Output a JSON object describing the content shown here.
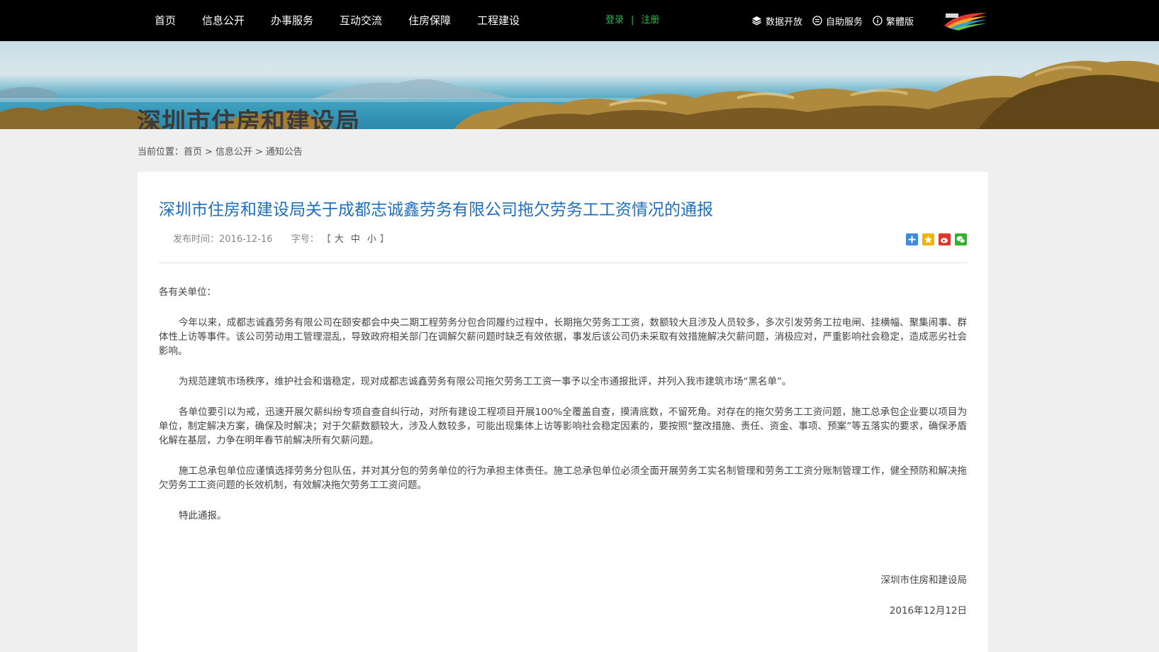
{
  "nav": {
    "items": [
      "首页",
      "信息公开",
      "办事服务",
      "互动交流",
      "住房保障",
      "工程建设"
    ],
    "login": "登录",
    "separator": "|",
    "register": "注册",
    "tools": [
      {
        "label": "数据开放",
        "icon": "layers-icon"
      },
      {
        "label": "自助服务",
        "icon": "service-icon"
      },
      {
        "label": "繁體版",
        "icon": "info-icon"
      }
    ]
  },
  "banner": {
    "site_title": "深圳市住房和建设局"
  },
  "breadcrumb": {
    "prefix": "当前位置：",
    "items": [
      "首页",
      "信息公开",
      "通知公告"
    ],
    "sep": ">"
  },
  "article": {
    "title": "深圳市住房和建设局关于成都志诚鑫劳务有限公司拖欠劳务工工资情况的通报",
    "publish_label": "发布时间：2016-12-16",
    "font_label": "字号：",
    "font_open": "【",
    "font_options": [
      "大",
      "中",
      "小"
    ],
    "font_close": "】",
    "greeting": "各有关单位：",
    "paragraphs": [
      "今年以来，成都志诚鑫劳务有限公司在颐安都会中央二期工程劳务分包合同履约过程中，长期拖欠劳务工工资，数额较大且涉及人员较多，多次引发劳务工拉电闸、挂横幅、聚集闹事、群体性上访等事件。该公司劳动用工管理混乱，导致政府相关部门在调解欠薪问题时缺乏有效依据，事发后该公司仍未采取有效措施解决欠薪问题，消极应对，严重影响社会稳定，造成恶劣社会影响。",
      "为规范建筑市场秩序，维护社会和谐稳定，现对成都志诚鑫劳务有限公司拖欠劳务工工资一事予以全市通报批评，并列入我市建筑市场“黑名单”。",
      "各单位要引以为戒，迅速开展欠薪纠纷专项自查自纠行动，对所有建设工程项目开展100%全覆盖自查，摸清底数，不留死角。对存在的拖欠劳务工工资问题，施工总承包企业要以项目为单位，制定解决方案，确保及时解决；对于欠薪数额较大，涉及人数较多，可能出现集体上访等影响社会稳定因素的，要按照“整改措施、责任、资金、事项、预案”等五落实的要求，确保矛盾化解在基层，力争在明年春节前解决所有欠薪问题。",
      "施工总承包单位应谨慎选择劳务分包队伍，并对其分包的劳务单位的行为承担主体责任。施工总承包单位必须全面开展劳务工实名制管理和劳务工工资分账制管理工作，健全预防和解决拖欠劳务工工资问题的长效机制，有效解决拖欠劳务工工资问题。",
      "特此通报。"
    ],
    "signature": "深圳市住房和建设局",
    "date": "2016年12月12日"
  },
  "share": [
    {
      "icon": "share-more-icon",
      "color": "#3f8ad7"
    },
    {
      "icon": "qzone-icon",
      "color": "#f0b400"
    },
    {
      "icon": "weibo-icon",
      "color": "#e0352b"
    },
    {
      "icon": "wechat-icon",
      "color": "#2fb42c"
    }
  ]
}
